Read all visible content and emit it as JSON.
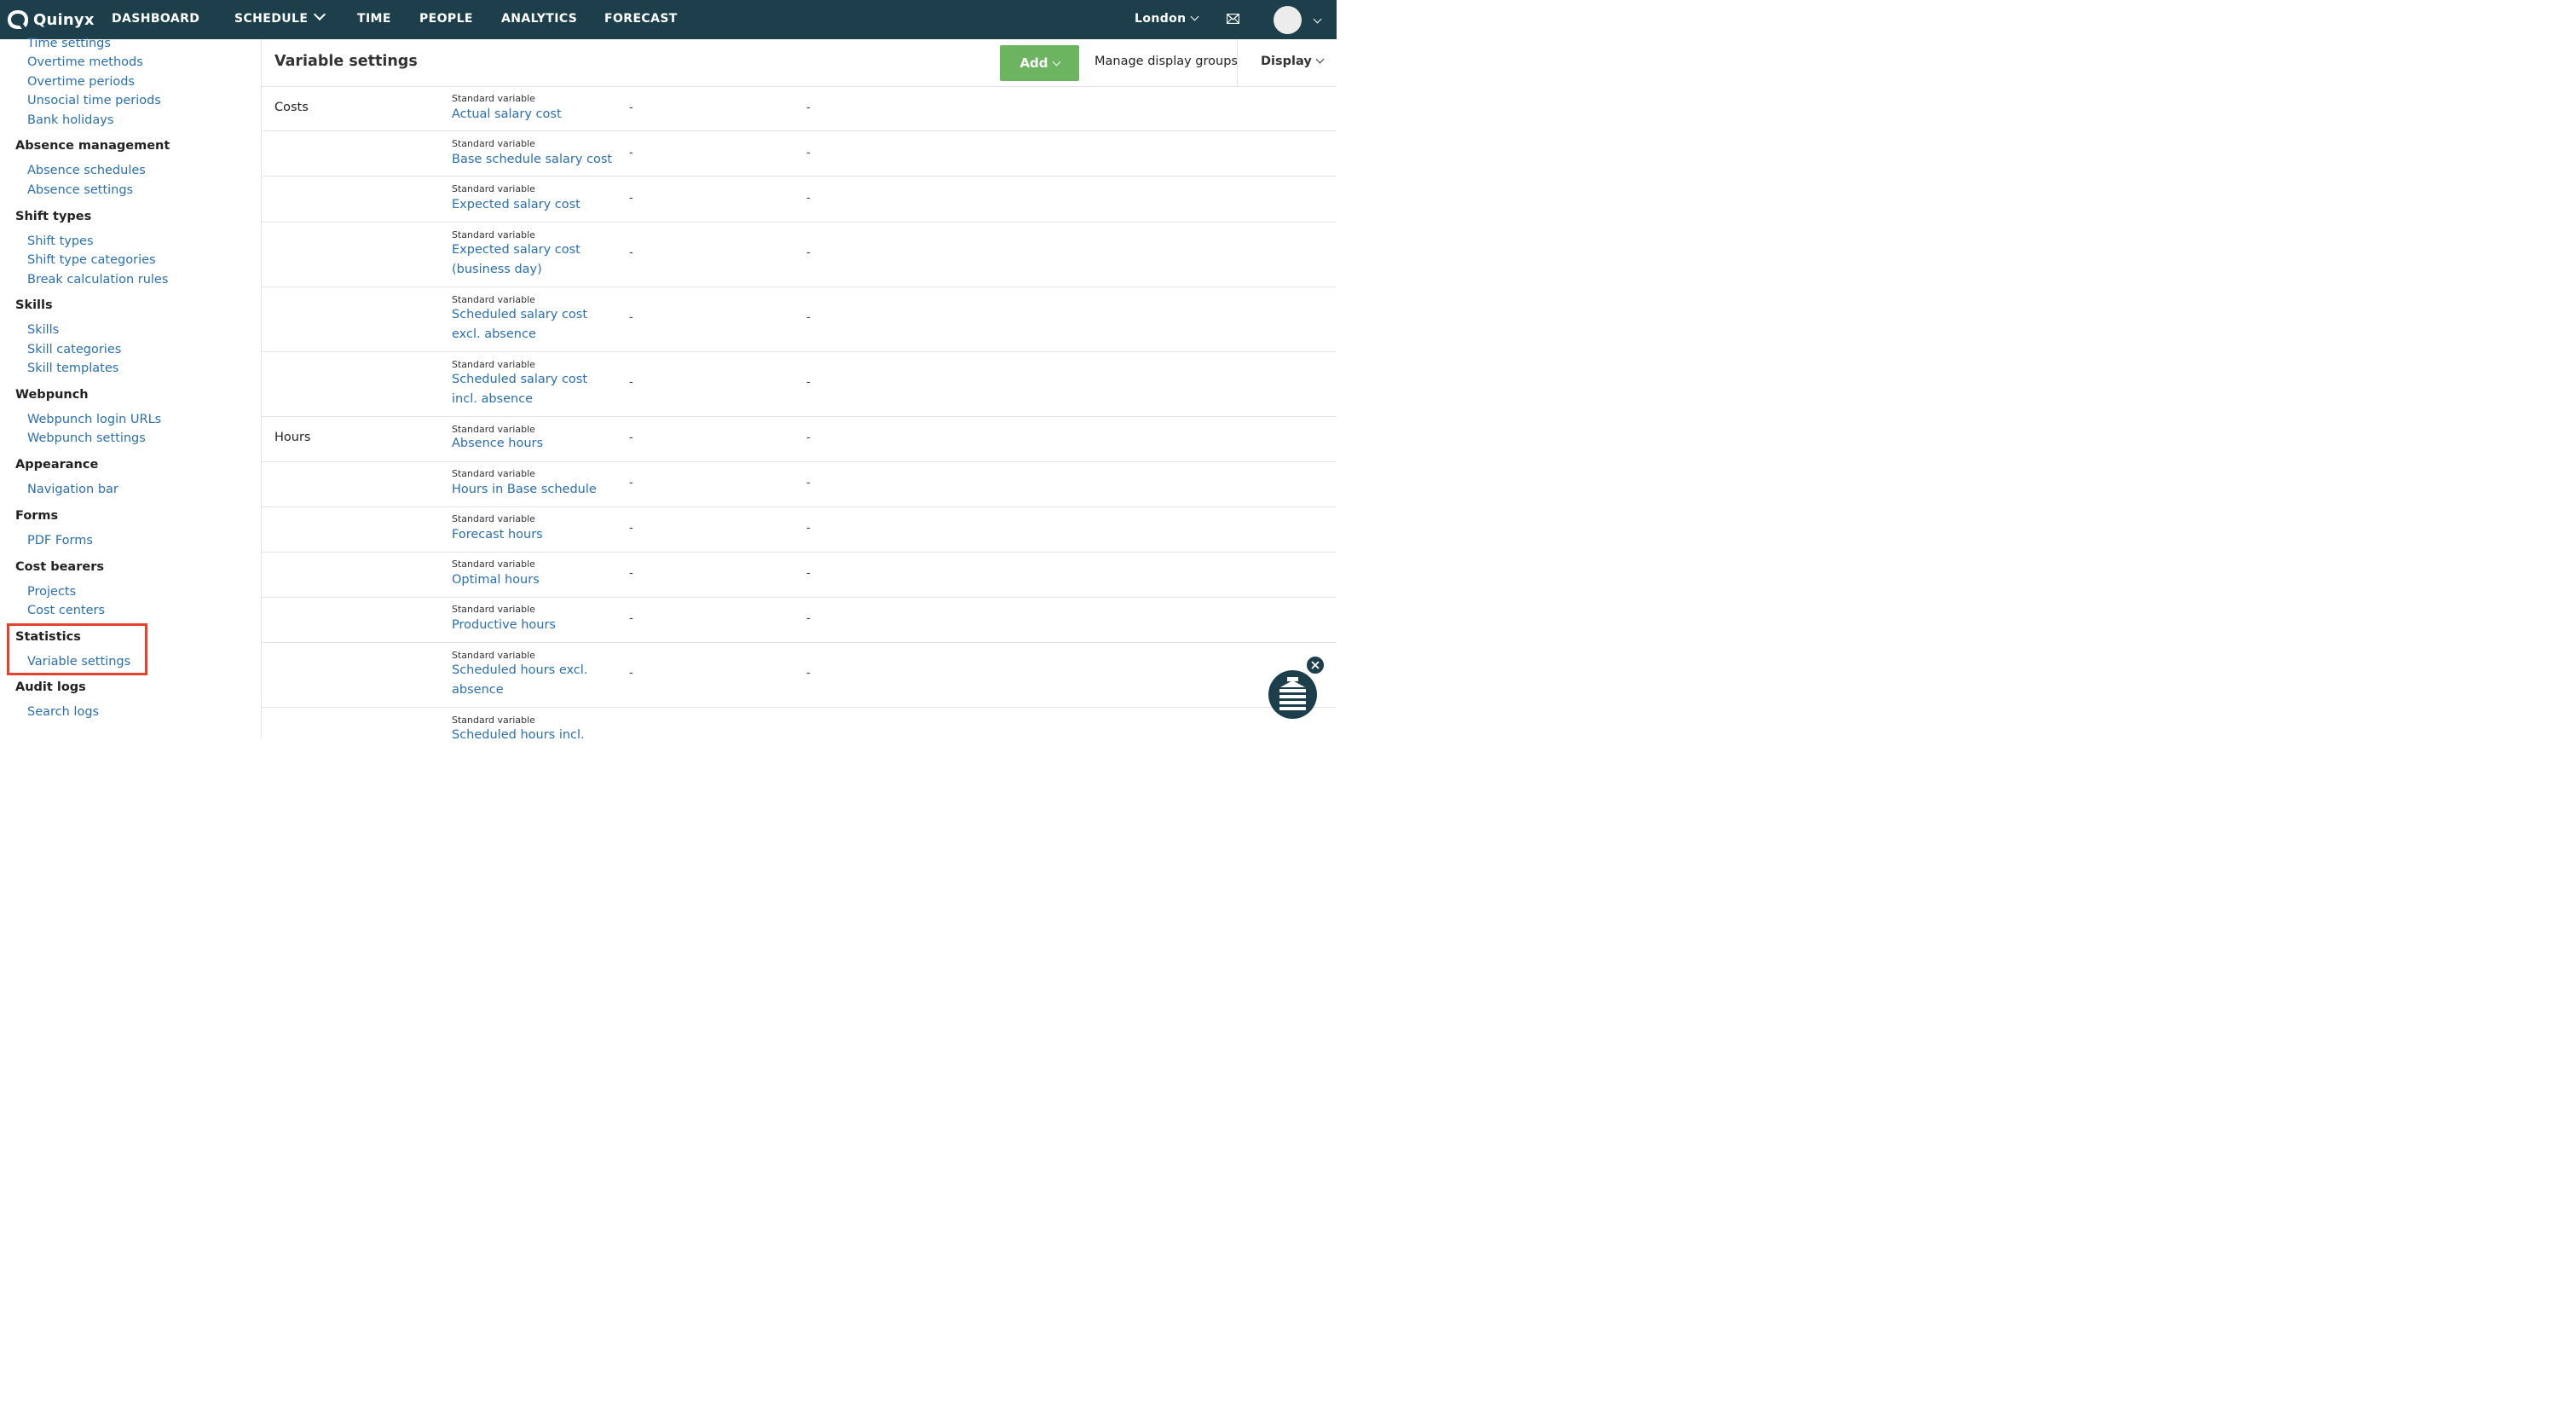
{
  "nav": {
    "logo": "Quinyx",
    "items": [
      "DASHBOARD",
      "SCHEDULE",
      "TIME",
      "PEOPLE",
      "ANALYTICS",
      "FORECAST"
    ],
    "location": "London"
  },
  "sidebar": {
    "time_settings": "Time settings",
    "overtime_methods": "Overtime methods",
    "overtime_periods": "Overtime periods",
    "unsocial_time_periods": "Unsocial time periods",
    "bank_holidays": "Bank holidays",
    "absence_management": "Absence management",
    "absence_schedules": "Absence schedules",
    "absence_settings": "Absence settings",
    "shift_types_head": "Shift types",
    "shift_types": "Shift types",
    "shift_type_categories": "Shift type categories",
    "break_calculation_rules": "Break calculation rules",
    "skills_head": "Skills",
    "skills": "Skills",
    "skill_categories": "Skill categories",
    "skill_templates": "Skill templates",
    "webpunch_head": "Webpunch",
    "webpunch_login_urls": "Webpunch login URLs",
    "webpunch_settings": "Webpunch settings",
    "appearance_head": "Appearance",
    "navigation_bar": "Navigation bar",
    "forms_head": "Forms",
    "pdf_forms": "PDF Forms",
    "cost_bearers_head": "Cost bearers",
    "projects": "Projects",
    "cost_centers": "Cost centers",
    "statistics_head": "Statistics",
    "variable_settings": "Variable settings",
    "audit_logs_head": "Audit logs",
    "search_logs": "Search logs"
  },
  "header": {
    "title": "Variable settings",
    "add_label": "Add",
    "manage_label": "Manage display groups",
    "display_label": "Display"
  },
  "table": {
    "rows": [
      {
        "group": "Costs",
        "sub": "Standard variable",
        "name": "Actual salary cost",
        "c1": "-",
        "c2": "-"
      },
      {
        "group": "",
        "sub": "Standard variable",
        "name": "Base schedule salary cost",
        "c1": "-",
        "c2": "-"
      },
      {
        "group": "",
        "sub": "Standard variable",
        "name": "Expected salary cost",
        "c1": "-",
        "c2": "-"
      },
      {
        "group": "",
        "sub": "Standard variable",
        "name": "Expected salary cost (business day)",
        "c1": "-",
        "c2": "-"
      },
      {
        "group": "",
        "sub": "Standard variable",
        "name": "Scheduled salary cost excl. absence",
        "c1": "-",
        "c2": "-"
      },
      {
        "group": "",
        "sub": "Standard variable",
        "name": "Scheduled salary cost incl. absence",
        "c1": "-",
        "c2": "-"
      },
      {
        "group": "Hours",
        "sub": "Standard variable",
        "name": "Absence hours",
        "c1": "-",
        "c2": "-"
      },
      {
        "group": "",
        "sub": "Standard variable",
        "name": "Hours in Base schedule",
        "c1": "-",
        "c2": "-"
      },
      {
        "group": "",
        "sub": "Standard variable",
        "name": "Forecast hours",
        "c1": "-",
        "c2": "-"
      },
      {
        "group": "",
        "sub": "Standard variable",
        "name": "Optimal hours",
        "c1": "-",
        "c2": "-"
      },
      {
        "group": "",
        "sub": "Standard variable",
        "name": "Productive hours",
        "c1": "-",
        "c2": "-"
      },
      {
        "group": "",
        "sub": "Standard variable",
        "name": "Scheduled hours excl. absence",
        "c1": "-",
        "c2": "-"
      },
      {
        "group": "",
        "sub": "Standard variable",
        "name": "Scheduled hours incl.",
        "c1": "",
        "c2": ""
      }
    ]
  },
  "colors": {
    "topbar": "#1d3f4b",
    "link": "#2a6fad",
    "add_button": "#6cb45f",
    "highlight": "#e5412d"
  },
  "icons": [
    "quinyx-logo-icon",
    "chevron-down-icon",
    "mail-icon",
    "avatar",
    "close-icon",
    "help-widget-icon"
  ]
}
